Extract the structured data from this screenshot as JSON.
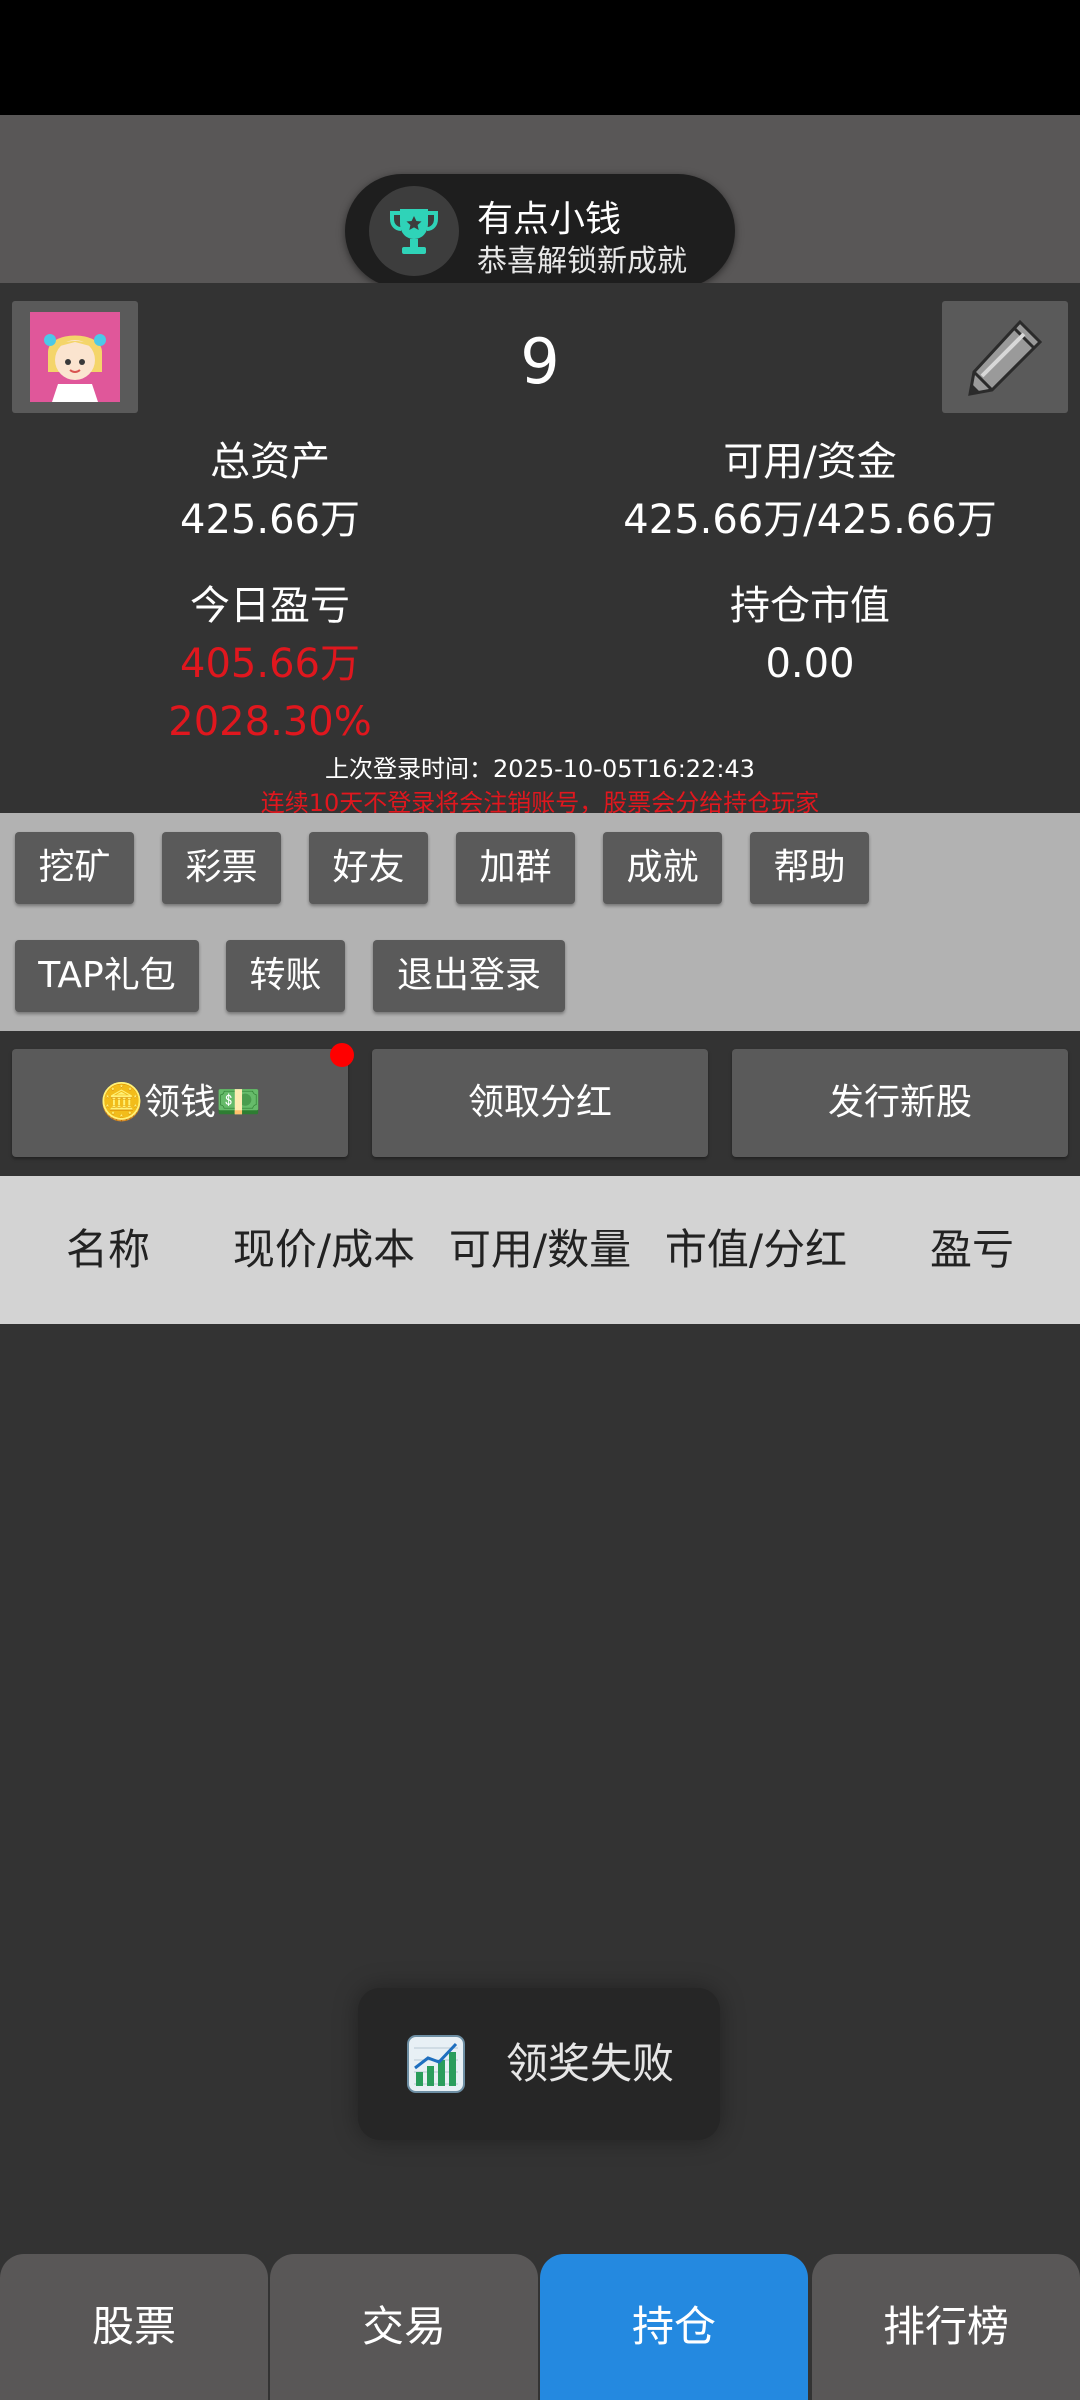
{
  "header": {
    "title": "持仓"
  },
  "achievement_toast": {
    "title": "有点小钱",
    "subtitle": "恭喜解锁新成就",
    "icon": "trophy-icon"
  },
  "profile": {
    "username": "9",
    "total_assets_label": "总资产",
    "total_assets_value": "425.66万",
    "available_funds_label": "可用/资金",
    "available_funds_value": "425.66万/425.66万",
    "today_pnl_label": "今日盈亏",
    "today_pnl_value": "405.66万",
    "today_pnl_percent": "2028.30%",
    "position_value_label": "持仓市值",
    "position_value_value": "0.00",
    "last_login": "上次登录时间：2025-10-05T16:22:43",
    "warning": "连续10天不登录将会注销账号，股票会分给持仓玩家"
  },
  "functions": [
    "挖矿",
    "彩票",
    "好友",
    "加群",
    "成就",
    "帮助",
    "TAP礼包",
    "转账",
    "退出登录"
  ],
  "actions": {
    "collect_money": "🪙领钱💵",
    "collect_dividend": "领取分红",
    "issue_stock": "发行新股"
  },
  "table": {
    "columns": [
      "名称",
      "现价/成本",
      "可用/数量",
      "市值/分红",
      "盈亏"
    ]
  },
  "toast": {
    "message": "领奖失败",
    "icon": "chart-increasing-icon"
  },
  "bottom_nav": {
    "tabs": [
      "股票",
      "交易",
      "持仓",
      "排行榜"
    ],
    "active": "持仓"
  },
  "colors": {
    "accent": "#2489e0",
    "loss_gain_red": "#e0171e",
    "background": "#333333"
  }
}
